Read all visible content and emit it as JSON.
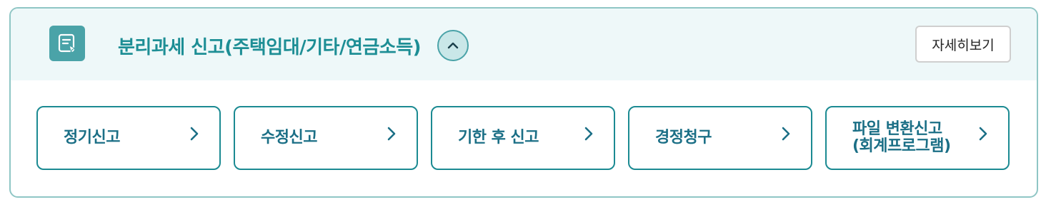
{
  "header": {
    "title": "분리과세 신고(주택임대/기타/연금소득)",
    "icon": "document-edit-icon",
    "collapse_icon": "chevron-up-icon",
    "detail_button": "자세히보기"
  },
  "cards": [
    {
      "label": "정기신고"
    },
    {
      "label": "수정신고"
    },
    {
      "label": "기한 후 신고"
    },
    {
      "label": "경정청구"
    },
    {
      "label": "파일 변환신고\n(회계프로그램)"
    }
  ],
  "colors": {
    "accent": "#1b8a92",
    "header_bg": "#eef8f9",
    "icon_bg": "#4aa3a8",
    "title_text": "#1d8e95"
  }
}
